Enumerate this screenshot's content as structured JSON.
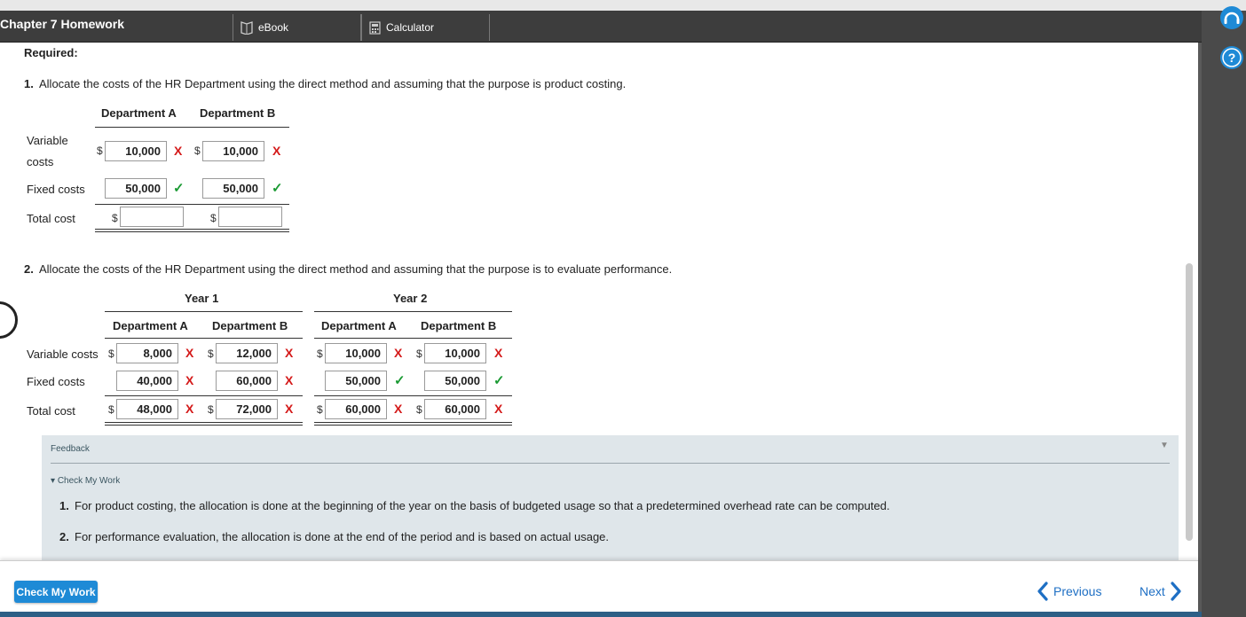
{
  "header": {
    "title": "Chapter 7 Homework",
    "tabs": [
      {
        "label": "eBook",
        "icon": "ebook-icon"
      },
      {
        "label": "Calculator",
        "icon": "calculator-icon"
      }
    ]
  },
  "rail": {
    "icons": [
      "headset-icon",
      "help-icon"
    ]
  },
  "required_label": "Required:",
  "part1": {
    "number": "1.",
    "text": "Allocate the costs of the HR Department using the direct method and assuming that the purpose is product costing.",
    "columns": [
      "Department A",
      "Department B"
    ],
    "rows": [
      {
        "label_line1": "Variable",
        "label_line2": "costs",
        "a": "10,000",
        "a_status": "X",
        "b": "10,000",
        "b_status": "X"
      },
      {
        "label": "Fixed costs",
        "a": "50,000",
        "a_status": "✓",
        "b": "50,000",
        "b_status": "✓"
      },
      {
        "label": "Total cost",
        "a": "",
        "b": ""
      }
    ]
  },
  "part2": {
    "number": "2.",
    "text": "Allocate the costs of the HR Department using the direct method and assuming that the purpose is to evaluate performance.",
    "year1": "Year 1",
    "year2": "Year 2",
    "columns": [
      "Department A",
      "Department B",
      "Department A",
      "Department B"
    ],
    "rows": [
      {
        "label": "Variable costs",
        "values": [
          "8,000",
          "12,000",
          "10,000",
          "10,000"
        ],
        "status": [
          "X",
          "X",
          "X",
          "X"
        ]
      },
      {
        "label": "Fixed costs",
        "values": [
          "40,000",
          "60,000",
          "50,000",
          "50,000"
        ],
        "status": [
          "X",
          "X",
          "✓",
          "✓"
        ]
      },
      {
        "label": "Total cost",
        "values": [
          "48,000",
          "72,000",
          "60,000",
          "60,000"
        ],
        "status": [
          "X",
          "X",
          "X",
          "X"
        ]
      }
    ]
  },
  "currency": "$",
  "feedback": {
    "label": "Feedback",
    "section": "Check My Work",
    "items": [
      {
        "number": "1.",
        "text": "For product costing, the allocation is done at the beginning of the year on the basis of budgeted usage so that a predetermined overhead rate can be computed."
      },
      {
        "number": "2.",
        "text": "For performance evaluation, the allocation is done at the end of the period and is based on actual usage."
      }
    ]
  },
  "footer": {
    "check_button": "Check My Work",
    "previous": "Previous",
    "next": "Next"
  },
  "colors": {
    "accent": "#1e8ad6",
    "error": "#d41a1a",
    "ok": "#1a9a33",
    "header": "#3d3d3d"
  }
}
